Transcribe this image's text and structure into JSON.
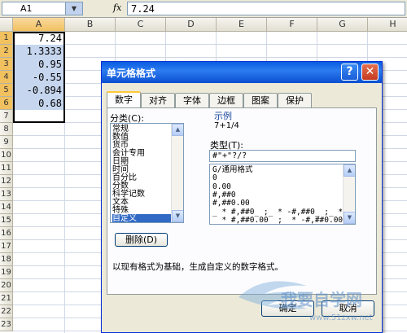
{
  "formula_bar": {
    "name_box": "A1",
    "fx": "fx",
    "formula": "7.24"
  },
  "columns": [
    "A",
    "B",
    "C",
    "D",
    "E",
    "F",
    "G",
    "H"
  ],
  "rows": [
    "1",
    "2",
    "3",
    "4",
    "5",
    "6",
    "7",
    "8",
    "9",
    "10",
    "11",
    "12",
    "13",
    "14",
    "15",
    "16",
    "17",
    "18",
    "19",
    "20",
    "21",
    "22",
    "23"
  ],
  "cells": [
    "7.24",
    "1.3333",
    "0.95",
    "-0.55",
    "-0.894",
    "0.68"
  ],
  "dialog": {
    "title": "单元格格式",
    "help": "?",
    "close": "✕",
    "tabs": [
      "数字",
      "对齐",
      "字体",
      "边框",
      "图案",
      "保护"
    ],
    "category_label": "分类(C):",
    "categories": [
      "常规",
      "数值",
      "货币",
      "会计专用",
      "日期",
      "时间",
      "百分比",
      "分数",
      "科学记数",
      "文本",
      "特殊",
      "自定义"
    ],
    "selected_category": "自定义",
    "sample_label": "示例",
    "sample_value": "7+1/4",
    "type_label": "类型(T):",
    "type_value": "#\"+\"?/?",
    "formats": [
      "G/通用格式",
      "0",
      "0.00",
      "#,##0",
      "#,##0.00",
      "_ * #,##0_ ;_ * -#,##0_ ;_ * \"",
      "_ * #,##0.00_ ;_ * -#,##0.00_ ;_ *"
    ],
    "delete_label": "删除(D)",
    "description": "以现有格式为基础，生成自定义的数字格式。",
    "ok_label": "确定",
    "cancel_label": "取消"
  },
  "watermark": {
    "text": "我要自学网",
    "url": "www.51zxw.net"
  }
}
